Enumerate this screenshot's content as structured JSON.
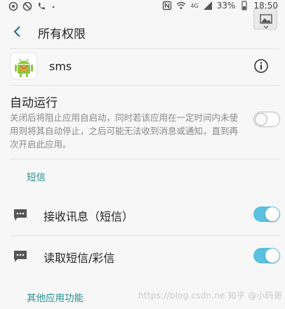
{
  "status_bar": {
    "battery": "33%",
    "time": "18:50",
    "network_label": "4G",
    "colors": {
      "icon": "#555555"
    }
  },
  "toolbar": {
    "back_icon": "chevron-left-icon",
    "title": "所有权限"
  },
  "app": {
    "icon": "android-robot-icon",
    "name": "sms",
    "info_icon": "info-icon"
  },
  "autorun": {
    "title": "自动运行",
    "description": "关闭后将阻止应用自启动，同时若该应用在一定时间内未使用则将其自动停止，之后可能无法收到消息或通知，直到再次开启此应用。",
    "enabled": false
  },
  "sections": [
    {
      "header": "短信"
    },
    {
      "header": "其他应用功能"
    }
  ],
  "permissions": [
    {
      "label": "接收讯息（短信）",
      "icon": "message-icon",
      "enabled": true
    },
    {
      "label": "读取短信/彩信",
      "icon": "message-icon",
      "enabled": true
    }
  ],
  "colors": {
    "accent": "#2a8f8f",
    "switch_on": "#5bc0e0",
    "text_primary": "#222222",
    "text_secondary": "#888888",
    "background": "#f7f7f7"
  },
  "watermark": "https://blog.csdn.ne  知乎 @小码哥"
}
